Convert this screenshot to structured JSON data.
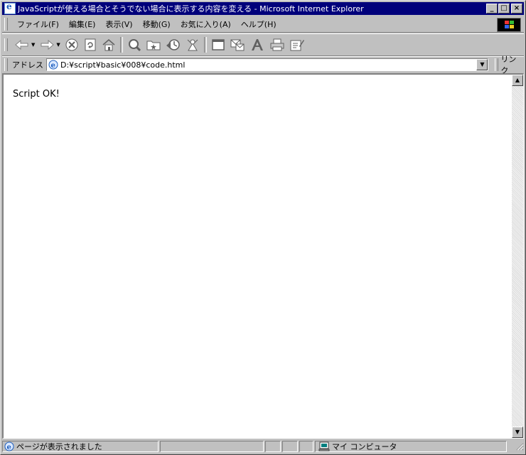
{
  "window": {
    "title": "JavaScriptが使える場合とそうでない場合に表示する内容を変える - Microsoft Internet Explorer",
    "minimize_glyph": "_",
    "maximize_glyph": "□",
    "close_glyph": "×"
  },
  "menubar": {
    "items": [
      {
        "label": "ファイル(F)"
      },
      {
        "label": "編集(E)"
      },
      {
        "label": "表示(V)"
      },
      {
        "label": "移動(G)"
      },
      {
        "label": "お気に入り(A)"
      },
      {
        "label": "ヘルプ(H)"
      }
    ]
  },
  "toolbar": {
    "buttons": [
      "back-icon",
      "forward-icon",
      "stop-icon",
      "refresh-icon",
      "home-icon",
      "search-icon",
      "favorites-icon",
      "history-icon",
      "channels-icon",
      "fullscreen-icon",
      "mail-icon",
      "font-icon",
      "print-icon",
      "edit-icon"
    ]
  },
  "address": {
    "label": "アドレス",
    "value": "D:¥script¥basic¥008¥code.html"
  },
  "links": {
    "label": "リンク"
  },
  "page": {
    "body_text": "Script OK!"
  },
  "status": {
    "message": "ページが表示されました",
    "zone": "マイ コンピュータ"
  },
  "colors": {
    "titlebar": "#00007b",
    "chrome": "#c0c0c0",
    "content_bg": "#ffffff"
  }
}
